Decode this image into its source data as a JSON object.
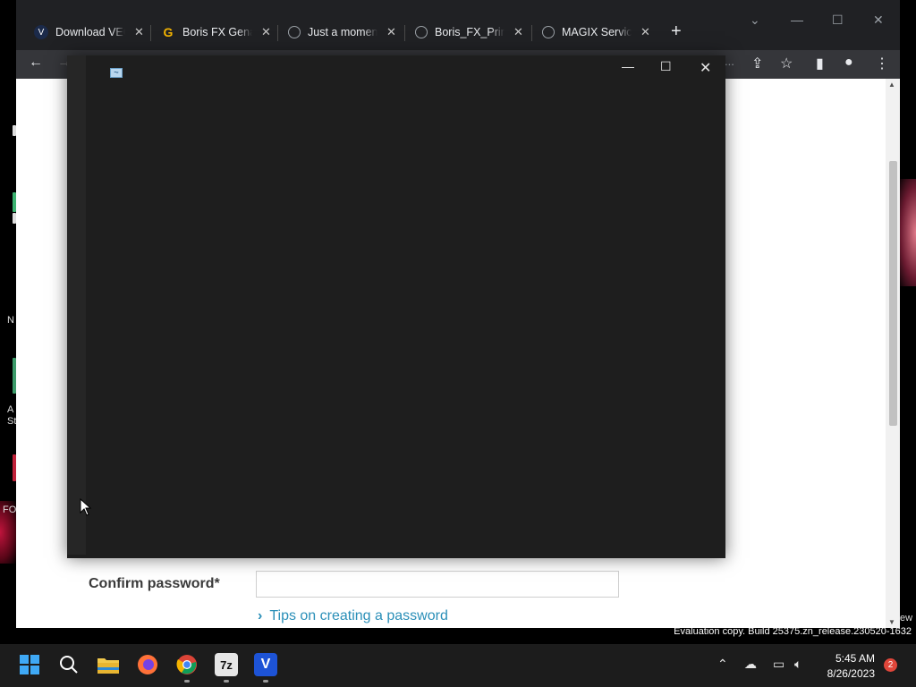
{
  "desktop": {
    "fragments": [
      "N",
      "A",
      "St",
      "FO"
    ]
  },
  "browser": {
    "tabs": [
      {
        "title": "Download VEG",
        "favicon": "V",
        "favicon_color": "#1b2a4a"
      },
      {
        "title": "Boris FX Genar",
        "favicon": "G",
        "favicon_color": "#f4b400"
      },
      {
        "title": "Just a moment",
        "favicon": "globe-icon",
        "favicon_color": "#9aa0a6"
      },
      {
        "title": "Boris_FX_Primo",
        "favicon": "globe-icon",
        "favicon_color": "#9aa0a6"
      },
      {
        "title": "MAGIX Service",
        "favicon": "globe-icon",
        "favicon_color": "#9aa0a6"
      }
    ],
    "toolbar": {
      "omnibox_fragment": "..."
    },
    "page": {
      "confirm_password_label": "Confirm password*",
      "tips_link": "Tips on creating a password"
    }
  },
  "watermark": {
    "text": "Evaluation copy. Build 25375.zn_release.230520-1632",
    "fragment": "ew"
  },
  "taskbar": {
    "clock_time": "5:45 AM",
    "clock_date": "8/26/2023",
    "notification_count": "2",
    "apps": [
      "start",
      "search",
      "file-explorer",
      "firefox",
      "chrome",
      "7zip",
      "vegas"
    ]
  }
}
